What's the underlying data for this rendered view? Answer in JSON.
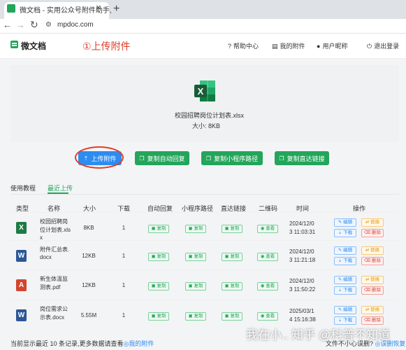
{
  "browser": {
    "tab_title": "微文档 - 实用公众号附件助手,",
    "tab_close": "×",
    "new_tab": "+",
    "url": "mpdoc.com",
    "back": "←",
    "forward": "→",
    "reload": "↻"
  },
  "header": {
    "logo": "微文档",
    "annotation": "①上传附件",
    "links": [
      "帮助中心",
      "我的附件",
      "用户昵称",
      "退出登录"
    ],
    "link_icons": [
      "help-circle-icon",
      "document-icon",
      "user-icon",
      "power-icon"
    ]
  },
  "preview": {
    "file_name": "校园招聘岗位计划表.xlsx",
    "file_size": "大小:  8KB"
  },
  "actions": {
    "upload": "上传附件",
    "copy_reply": "复制自动回复",
    "copy_mini": "复制小程序路径",
    "copy_link": "复制直达链接"
  },
  "tabs": {
    "tutorial": "使用教程",
    "recent": "最近上传"
  },
  "table": {
    "headers": [
      "类型",
      "名称",
      "大小",
      "下载",
      "自动回复",
      "小程序路径",
      "直达链接",
      "二维码",
      "时间",
      "操作"
    ],
    "copy_label": "复制",
    "view_label": "查看",
    "edit_label": "编辑",
    "replace_label": "替换",
    "download_label": "下载",
    "delete_label": "删除",
    "rows": [
      {
        "type": "xlsx",
        "name": [
          "校园招聘岗",
          "位计划表.xls",
          "x"
        ],
        "size": "8KB",
        "downloads": "1",
        "time": [
          "2024/12/0",
          "3 11:03:31"
        ]
      },
      {
        "type": "docx",
        "name": [
          "附件汇总表.",
          "docx"
        ],
        "size": "12KB",
        "downloads": "1",
        "time": [
          "2024/12/0",
          "3 11:21:18"
        ]
      },
      {
        "type": "pdf",
        "name": [
          "新生体温监",
          "测表.pdf"
        ],
        "size": "12KB",
        "downloads": "1",
        "time": [
          "2024/12/0",
          "3 11:50:22"
        ]
      },
      {
        "type": "docx",
        "name": [
          "岗位需求公",
          "示表.docx"
        ],
        "size": "5.55M",
        "downloads": "1",
        "time": [
          "2025/03/1",
          "4 15:16:38"
        ]
      }
    ]
  },
  "footer": {
    "text": "当前显示最近 10 条记录,更多数据请查看",
    "link": "◎我的附件",
    "feedback": "文件不小心误删? ",
    "feedback_link": "◎误删恢复",
    "watermark": "我在小..  知乎 @科普不知道"
  },
  "colors": {
    "green": "#23a55a",
    "blue": "#2d8cf0",
    "annotation_red": "#e03d2b"
  }
}
